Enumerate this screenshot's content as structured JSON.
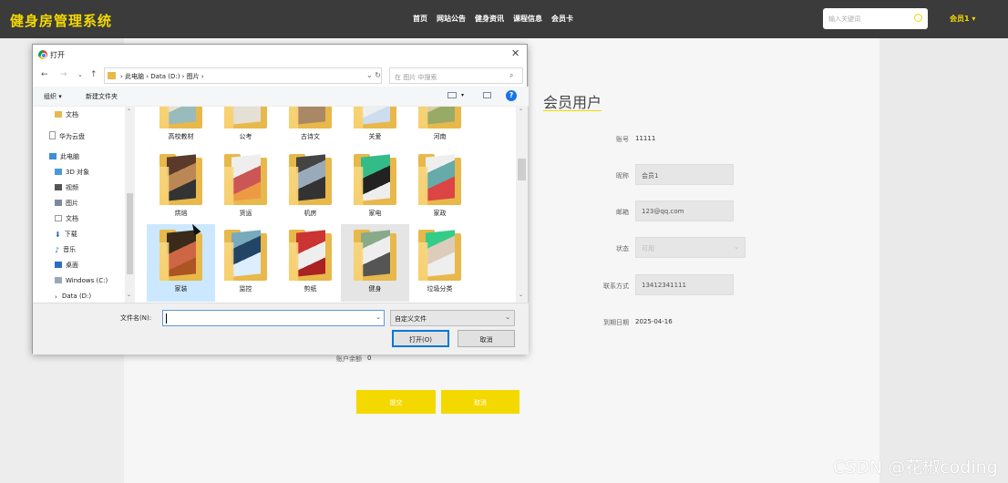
{
  "topbar": {
    "brand": "健身房管理系统",
    "nav": [
      "首页",
      "网站公告",
      "健身资讯",
      "课程信息",
      "会员卡"
    ],
    "search_placeholder": "输入关键词",
    "user_menu": "会员1 ▾"
  },
  "profile": {
    "title": "会员用户",
    "fields": {
      "account_label": "账号",
      "account_value": "11111",
      "nickname_label": "昵称",
      "nickname_value": "会员1",
      "email_label": "邮箱",
      "email_value": "123@qq.com",
      "status_label": "状态",
      "status_value": "可用",
      "phone_label": "联系方式",
      "phone_value": "13412341111",
      "expire_label": "到期日期",
      "expire_value": "2025-04-16",
      "balance_label": "账户余额",
      "balance_value": "0"
    },
    "submit_label": "提交",
    "cancel_label": "取消"
  },
  "watermark": "CSDN @花椒coding",
  "dialog": {
    "title": "打开",
    "close": "✕",
    "breadcrumb": "›  此电脑  ›  Data (D:)  ›  图片  ›",
    "search_placeholder": "在 图片 中搜索",
    "toolbar": {
      "organize": "组织 ▾",
      "new_folder": "新建文件夹",
      "help": "?"
    },
    "nav_items": [
      {
        "label": "文档",
        "icon": "folder-icon"
      },
      {
        "label": "华为云盘",
        "icon": "cloud-drive-icon"
      },
      {
        "label": "此电脑",
        "icon": "computer-icon"
      },
      {
        "label": "3D 对象",
        "icon": "3d-objects-icon"
      },
      {
        "label": "视频",
        "icon": "video-icon"
      },
      {
        "label": "图片",
        "icon": "pictures-icon"
      },
      {
        "label": "文档",
        "icon": "document-icon"
      },
      {
        "label": "下载",
        "icon": "download-icon"
      },
      {
        "label": "音乐",
        "icon": "music-icon"
      },
      {
        "label": "桌面",
        "icon": "desktop-icon"
      },
      {
        "label": "Windows (C:)",
        "icon": "drive-icon"
      },
      {
        "label": "Data (D:)",
        "icon": "drive-icon"
      }
    ],
    "folders": [
      {
        "label": "高校教材"
      },
      {
        "label": "公考"
      },
      {
        "label": "古诗文"
      },
      {
        "label": "关爱"
      },
      {
        "label": "河南"
      },
      {
        "label": "烘焙"
      },
      {
        "label": "货运"
      },
      {
        "label": "机房"
      },
      {
        "label": "家电"
      },
      {
        "label": "家政"
      },
      {
        "label": "家装"
      },
      {
        "label": "监控"
      },
      {
        "label": "剪纸"
      },
      {
        "label": "健身"
      },
      {
        "label": "垃圾分类"
      }
    ],
    "filename_label": "文件名(N):",
    "filename_value": "",
    "filetype": "自定义文件",
    "open_label": "打开(O)",
    "cancel_label": "取消"
  },
  "colors": {
    "accent": "#f3d900",
    "topbar": "#3b3b3b"
  }
}
